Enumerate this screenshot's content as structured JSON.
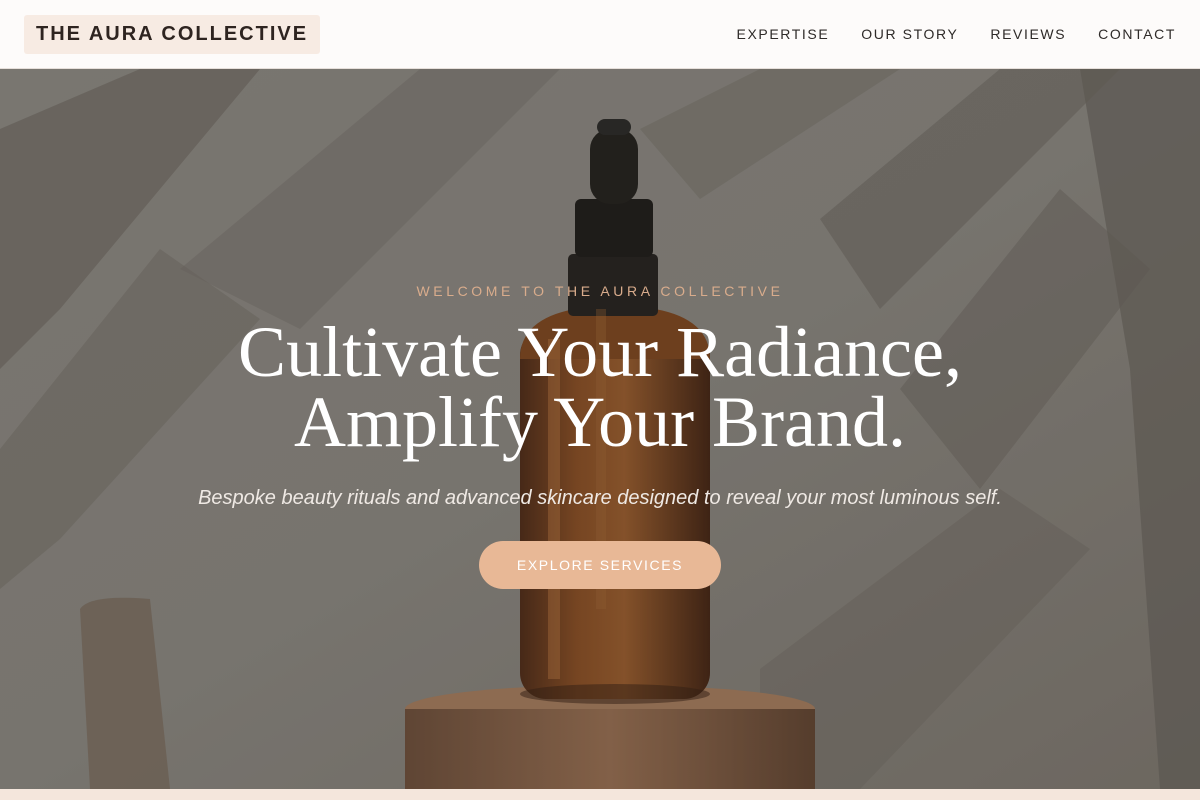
{
  "header": {
    "logo": "THE AURA COLLECTIVE",
    "nav": [
      "EXPERTISE",
      "OUR STORY",
      "REVIEWS",
      "CONTACT"
    ]
  },
  "hero": {
    "eyebrow": "WELCOME TO THE AURA COLLECTIVE",
    "headline_line1": "Cultivate Your Radiance,",
    "headline_line2": "Amplify Your Brand.",
    "subtitle": "Bespoke beauty rituals and advanced skincare designed to reveal your most luminous self.",
    "cta_label": "EXPLORE SERVICES"
  },
  "colors": {
    "accent": "#e8b896",
    "eyebrow": "#d9ac8c",
    "header_bg": "#fdfbfa",
    "logo_bg": "#f7ebe3"
  }
}
